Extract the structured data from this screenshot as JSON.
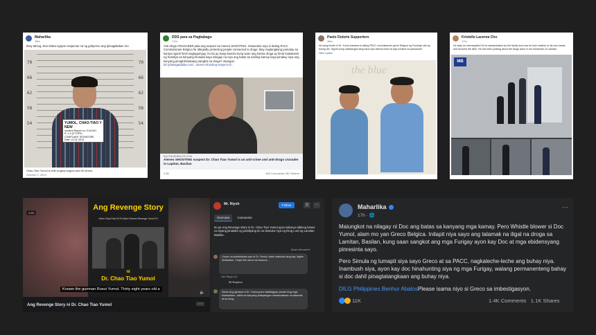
{
  "posts": {
    "p1": {
      "author": "Maharlika",
      "time": "18m",
      "text": "Bray talong, Doc! Baka ngayon mapunan na ng gobyerno ang ipinaglalaban mo.",
      "board": {
        "line1": "YUMOL, CHAO-TIAO Y",
        "line2": "NEW",
        "line3": "Incident Report no: IS-M-001\nR. 1.4 (5 TOPS)\nCOMPLAINT SIGNATURE\nDate: 10-31-2019",
        "line4": "IN"
      },
      "footer_name": "Chao-Tiao Yumol is with Angela Angela and 65 others.",
      "footer_date": "October 1, 2019"
    },
    "p2": {
      "author": "DDS para sa Pagbabago",
      "time": "17m",
      "text": "Anti drugs CRUSADER pala ang suspect sa Ateneo SHOOTING. Kinasuhan niya si dating PACC Commissioner Belgica for allegedly protecting people connected to drugs. May nagtangkang pumatay sa kaniya ngunit hindi nagtagumpay. Ito ba ay isang kwento kung saan ang kontra droga ay hindi makakamit ng hustisya sa kanyang krusada kaya inilagay na niya ang batas sa sariling kamay kaya pinakay niya ang kanyang pinaghihinalaang sangkot sa droga? Abangan.",
      "link_url": "bit.ly/kalagatdalita.com/...ateneo-shooting-suspect-di...",
      "link_domain": "BALITAHANBALITA.COM",
      "link_title": "Ateneo SHOOTING suspect Dr. Chao Tiao Yumol is an anti-crime and anti-drugs crusader in Lapitan, Basilan",
      "reactions": "3.6K",
      "stats": "463 Comments   281 Shares"
    },
    "p3": {
      "author": "Paolo Duterte Supporters",
      "time": "18m",
      "text": "No song hindlo ni Dr. Yumol kasama si dating PACC commissioner greco Belgica ng Furnhigh sila ng tulong din. Sigurd kung natabangan lang sana siya dati sa hindi na siya umabot sa pamamaril.",
      "mention": "Nikki Lipskie",
      "watermark": "the blue"
    },
    "p4": {
      "author": "Kristelle Lacerna Cho",
      "time": "17m",
      "text": "He says he was targeted 3x for assassination by the family and now he took matters to his own hands and became the killer. He has been posting about the drugs issue in his hometown of Lamitan.",
      "logo": "MB"
    },
    "video": {
      "headline": "Ang Revenge Story",
      "caption": "Video Clips Para Di Pa More Scenes Revenge Yumol Ph",
      "ni": "ni",
      "doctor": "Dr. Chao Tiao Yumol",
      "subtitle": "Known the gunman Ruezi Yumol. Thirty eight years old a",
      "title": "Ang Revenge Story ni Dr. Chao Tiao Yumol",
      "badge": "1:15"
    },
    "side": {
      "author": "Mr. Riyoh",
      "time": "",
      "follow": "Follow",
      "tab_overview": "Overview",
      "tab_comments": "Comments",
      "text": "Ito po Ang Revenge Story ni Dr. Chao Tiao Yumol ayon sakanya laltieng beses na siyang pinatakn ng pamilyang ito na tinutuso niya ng Drug Lord ng Lamitan Basilan.",
      "most_relevant": "Most relevant",
      "comment1": "I hope na protektahan yan si Dr. Yumol, baka mabulad lang kay Jaybe Sebastian...Hope this serve as lessons...",
      "comment1_actions": "Like   Reply   11h",
      "replies": "50 Replies",
      "comment2": "Same Ang ginawa ni Dr. Yumol,para mabibigyan pansin Ang mga kinasuklam...dahil sa kanyang katapangan matuturalasan na tatamak at ka llong.",
      "comment1_count": "70"
    },
    "main": {
      "author": "Maharlika",
      "time": "17h · ",
      "para1": "Maiungkot na nilagay ni Doc ang batas sa kanyang mga kamay. Pero Whistle blower si Doc Yumol, alam mo yan Greco Belgica. Inilapit niya sayo ang talamak na iligal na droga sa Lamitan, Basilan, kung saan sangkot ang mga Furigay ayon kay Doc  at mga ebidensyang pinresinta sayo.",
      "para2": "Pero Simula ng lumapit siya sayo Greco at sa PACC, nagkaleche-leche ang buhay niya. Inambush siya, ayon kay doc hinahunting siya ng mga Furigay, walang permanenteng bahay si doc dahil pinagtatangkaan ang buhay niya.",
      "para3_link": "DILG Philippines Benhur Abalos",
      "para3_rest": "Please isama niyo si Greco sa imbestigasyon.",
      "reactions": "11K",
      "comments": "1.4K Comments",
      "shares": "1.1K Shares"
    }
  },
  "colors": {
    "page_bg": "#1f1f1f",
    "fb_blue": "#2d88ff",
    "headline_yellow": "#ffd400"
  }
}
